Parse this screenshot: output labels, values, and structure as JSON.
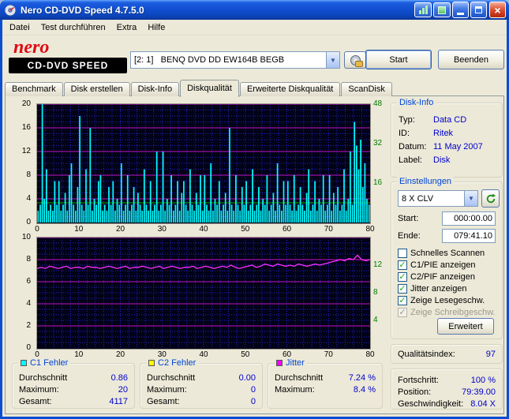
{
  "window": {
    "title": "Nero CD-DVD Speed 4.7.5.0"
  },
  "menu": {
    "items": [
      "Datei",
      "Test durchführen",
      "Extra",
      "Hilfe"
    ]
  },
  "logo": {
    "brand": "nero",
    "product": "CD-DVD SPEED"
  },
  "toolbar": {
    "drive": "[2: 1]   BENQ DVD DD EW164B BEGB",
    "start": "Start",
    "quit": "Beenden"
  },
  "tabs": {
    "items": [
      "Benchmark",
      "Disk erstellen",
      "Disk-Info",
      "Diskqualität",
      "Erweiterte Diskqualität",
      "ScanDisk"
    ],
    "active_index": 3
  },
  "disk_info": {
    "title": "Disk-Info",
    "rows": [
      {
        "label": "Typ:",
        "value": "Data CD"
      },
      {
        "label": "ID:",
        "value": "Ritek"
      },
      {
        "label": "Datum:",
        "value": "11 May 2007"
      },
      {
        "label": "Label:",
        "value": "Disk"
      }
    ]
  },
  "settings": {
    "title": "Einstellungen",
    "speed": "8 X CLV",
    "start_label": "Start:",
    "start_value": "000:00.00",
    "end_label": "Ende:",
    "end_value": "079:41.10",
    "checkboxes": [
      {
        "label": "Schnelles Scannen",
        "checked": false,
        "disabled": false
      },
      {
        "label": "C1/PIE anzeigen",
        "checked": true,
        "disabled": false
      },
      {
        "label": "C2/PIF anzeigen",
        "checked": true,
        "disabled": false
      },
      {
        "label": "Jitter anzeigen",
        "checked": true,
        "disabled": false
      },
      {
        "label": "Zeige Lesegeschw.",
        "checked": true,
        "disabled": false
      },
      {
        "label": "Zeige Schreibgeschw.",
        "checked": true,
        "disabled": true
      }
    ],
    "advanced": "Erweitert"
  },
  "quality_index": {
    "label": "Qualitätsindex:",
    "value": "97"
  },
  "progress": {
    "rows": [
      {
        "label": "Fortschritt:",
        "value": "100 %"
      },
      {
        "label": "Position:",
        "value": "79:39.00"
      },
      {
        "label": "Geschwindigkeit:",
        "value": "8.04 X"
      }
    ]
  },
  "stats": [
    {
      "title": "C1 Fehler",
      "color": "#00ffff",
      "rows": [
        {
          "label": "Durchschnitt",
          "value": "0.86"
        },
        {
          "label": "Maximum:",
          "value": "20"
        },
        {
          "label": "Gesamt:",
          "value": "4117"
        }
      ]
    },
    {
      "title": "C2 Fehler",
      "color": "#ffff00",
      "rows": [
        {
          "label": "Durchschnitt",
          "value": "0.00"
        },
        {
          "label": "Maximum:",
          "value": "0"
        },
        {
          "label": "Gesamt:",
          "value": "0"
        }
      ]
    },
    {
      "title": "Jitter",
      "color": "#ff00ff",
      "rows": [
        {
          "label": "Durchschnitt",
          "value": "7.24 %"
        },
        {
          "label": "Maximum:",
          "value": "8.4 %"
        }
      ]
    }
  ],
  "chart_data": [
    {
      "type": "bar",
      "name": "c1-errors",
      "series_label": "C1 Fehler",
      "color": "#00ffff",
      "ylim": [
        0,
        20
      ],
      "yticks": [
        0,
        4,
        8,
        12,
        16,
        20
      ],
      "xlim": [
        0,
        80
      ],
      "xticks": [
        0,
        10,
        20,
        30,
        40,
        50,
        60,
        70,
        80
      ],
      "grid": {
        "minor_y": 1,
        "major_y": 4,
        "minor_x": 2
      },
      "right_axis": {
        "color": "#007a00",
        "ticks": [
          16,
          32,
          48
        ],
        "max": 48
      },
      "speed_line": {
        "value": 8,
        "color": "#007800"
      },
      "values": [
        2,
        3,
        20,
        4,
        9,
        2,
        3,
        2,
        7,
        3,
        7,
        2,
        3,
        5,
        2,
        8,
        10,
        3,
        2,
        6,
        18,
        3,
        2,
        9,
        3,
        16,
        2,
        4,
        3,
        7,
        8,
        2,
        3,
        2,
        6,
        3,
        7,
        2,
        4,
        3,
        10,
        2,
        3,
        8,
        2,
        3,
        6,
        2,
        5,
        3,
        2,
        9,
        3,
        2,
        7,
        2,
        3,
        12,
        2,
        3,
        12,
        2,
        4,
        3,
        8,
        2,
        3,
        7,
        2,
        5,
        7,
        3,
        2,
        9,
        3,
        2,
        5,
        3,
        8,
        2,
        8,
        3,
        2,
        10,
        2,
        4,
        3,
        7,
        2,
        3,
        5,
        2,
        16,
        3,
        2,
        8,
        3,
        2,
        6,
        3,
        7,
        2,
        3,
        9,
        2,
        3,
        6,
        2,
        4,
        3,
        8,
        2,
        3,
        5,
        2,
        10,
        3,
        2,
        7,
        3,
        7,
        3,
        2,
        8,
        2,
        3,
        6,
        3,
        2,
        5,
        9,
        2,
        3,
        7,
        2,
        4,
        3,
        8,
        2,
        3,
        8,
        2,
        5,
        3,
        6,
        2,
        3,
        9,
        2,
        4,
        12,
        3,
        17,
        13,
        9,
        14,
        6,
        10,
        4,
        3
      ]
    },
    {
      "type": "line",
      "name": "jitter",
      "series_label": "Jitter",
      "color": "#ff30ff",
      "ylim": [
        0,
        10
      ],
      "yticks": [
        0,
        2,
        4,
        6,
        8,
        10
      ],
      "xlim": [
        0,
        80
      ],
      "xticks": [
        0,
        10,
        20,
        30,
        40,
        50,
        60,
        70,
        80
      ],
      "grid": {
        "minor_y": 0.5,
        "major_y": 2,
        "minor_x": 2
      },
      "right_axis": {
        "color": "#007a00",
        "ticks": [
          4,
          8,
          12
        ],
        "max": 16
      },
      "values": [
        7.2,
        7.3,
        7.2,
        7.4,
        7.3,
        7.2,
        7.3,
        7.4,
        7.2,
        7.3,
        7.3,
        7.2,
        7.4,
        7.3,
        7.3,
        7.2,
        7.3,
        7.4,
        7.3,
        7.2,
        7.3,
        7.4,
        7.2,
        7.3,
        7.3,
        7.4,
        7.3,
        7.2,
        7.3,
        7.4,
        7.2,
        7.3,
        7.4,
        7.3,
        7.2,
        7.3,
        7.3,
        7.4,
        7.2,
        7.3,
        7.4,
        7.3,
        7.2,
        7.3,
        7.4,
        7.3,
        7.5,
        7.3,
        7.2,
        7.3,
        7.4,
        7.5,
        7.3,
        7.4,
        7.6,
        7.5,
        7.4,
        7.6,
        7.5,
        7.4,
        7.5,
        7.4,
        7.6,
        7.5,
        7.4,
        7.5,
        7.6,
        7.5,
        7.6,
        7.7,
        7.8,
        7.9,
        8.0,
        7.9,
        8.1,
        8.0,
        8.4,
        8.0,
        7.9,
        8.0
      ]
    }
  ]
}
